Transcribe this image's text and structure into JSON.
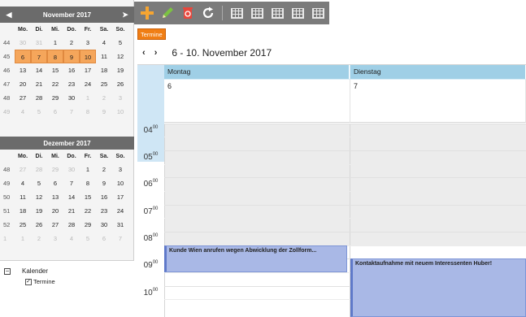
{
  "mini_calendars": [
    {
      "title": "November 2017",
      "prev_icon": "arrow-left-icon",
      "next_icon": "arrow-right-icon",
      "day_headers": [
        "Mo.",
        "Di.",
        "Mi.",
        "Do.",
        "Fr.",
        "Sa.",
        "So."
      ],
      "weeks": [
        {
          "wk": "44",
          "days": [
            "30",
            "31",
            "1",
            "2",
            "3",
            "4",
            "5"
          ]
        },
        {
          "wk": "45",
          "days": [
            "6",
            "7",
            "8",
            "9",
            "10",
            "11",
            "12"
          ]
        },
        {
          "wk": "46",
          "days": [
            "13",
            "14",
            "15",
            "16",
            "17",
            "18",
            "19"
          ]
        },
        {
          "wk": "47",
          "days": [
            "20",
            "21",
            "22",
            "23",
            "24",
            "25",
            "26"
          ]
        },
        {
          "wk": "48",
          "days": [
            "27",
            "28",
            "29",
            "30",
            "1",
            "2",
            "3"
          ]
        },
        {
          "wk": "49",
          "days": [
            "4",
            "5",
            "6",
            "7",
            "8",
            "9",
            "10"
          ]
        }
      ]
    },
    {
      "title": "Dezember 2017",
      "day_headers": [
        "Mo.",
        "Di.",
        "Mi.",
        "Do.",
        "Fr.",
        "Sa.",
        "So."
      ],
      "weeks": [
        {
          "wk": "48",
          "days": [
            "27",
            "28",
            "29",
            "30",
            "1",
            "2",
            "3"
          ]
        },
        {
          "wk": "49",
          "days": [
            "4",
            "5",
            "6",
            "7",
            "8",
            "9",
            "10"
          ]
        },
        {
          "wk": "50",
          "days": [
            "11",
            "12",
            "13",
            "14",
            "15",
            "16",
            "17"
          ]
        },
        {
          "wk": "51",
          "days": [
            "18",
            "19",
            "20",
            "21",
            "22",
            "23",
            "24"
          ]
        },
        {
          "wk": "52",
          "days": [
            "25",
            "26",
            "27",
            "28",
            "29",
            "30",
            "31"
          ]
        },
        {
          "wk": "1",
          "days": [
            "1",
            "2",
            "3",
            "4",
            "5",
            "6",
            "7"
          ]
        }
      ]
    }
  ],
  "tree": {
    "toggle": "⊟",
    "root_label": "Kalender",
    "child_label": "Termine",
    "child_checked": true
  },
  "toolbar": {
    "icons": [
      "add-icon",
      "edit-pencil-icon",
      "delete-icon",
      "refresh-icon",
      "day-view-icon",
      "work-week-view-icon",
      "week-view-icon",
      "month-view-icon",
      "timeline-view-icon"
    ]
  },
  "calendar": {
    "tab_label": "Termine",
    "nav_arrows": "‹ ›",
    "date_range": "6 - 10. November 2017",
    "columns": [
      {
        "day_name": "Montag",
        "date": "6"
      },
      {
        "day_name": "Dienstag",
        "date": "7"
      }
    ],
    "hours": [
      {
        "h": "04",
        "m": "00"
      },
      {
        "h": "05",
        "m": "00"
      },
      {
        "h": "06",
        "m": "00"
      },
      {
        "h": "07",
        "m": "00"
      },
      {
        "h": "08",
        "m": "00"
      },
      {
        "h": "09",
        "m": "00"
      },
      {
        "h": "10",
        "m": "00"
      }
    ],
    "appointments": [
      {
        "day": "Montag",
        "start": "08:00",
        "end": "09:00",
        "title": "Kunde Wien anrufen wegen Abwicklung der Zollform..."
      },
      {
        "day": "Dienstag",
        "start": "08:30",
        "end": "10:30",
        "title": "Kontaktaufnahme mit neuem Interessenten Huber!"
      }
    ]
  },
  "colors": {
    "accent_orange": "#f07e14",
    "selected_week": "#f5a65b",
    "appointment": "#a9b8e6",
    "day_header": "#9fcfe6"
  }
}
